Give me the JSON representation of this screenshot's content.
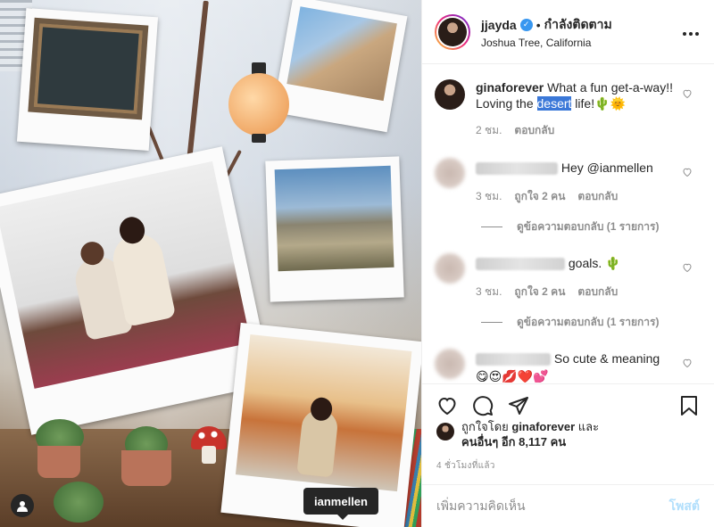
{
  "post": {
    "user_tag_tooltip": "ianmellen"
  },
  "header": {
    "username": "jjayda",
    "verified_mark": "✓",
    "separator": "•",
    "follow_status": "กำลังติดตาม",
    "location": "Joshua Tree, California",
    "more_icon": "more-horizontal-icon"
  },
  "comments": [
    {
      "username": "ginaforever",
      "text_before": "What a fun get-a-way!! Loving the ",
      "highlight": "desert",
      "text_after": " life!🌵🌞",
      "time": "2 ชม.",
      "likes": "",
      "reply": "ตอบกลับ"
    },
    {
      "username_blurred": true,
      "text": "Hey @ianmellen",
      "time": "3 ชม.",
      "likes": "ถูกใจ 2 คน",
      "reply": "ตอบกลับ",
      "view_replies": "ดูข้อความตอบกลับ (1 รายการ)"
    },
    {
      "username_blurred": true,
      "text": "goals. 🌵",
      "time": "3 ชม.",
      "likes": "ถูกใจ 2 คน",
      "reply": "ตอบกลับ",
      "view_replies": "ดูข้อความตอบกลับ (1 รายการ)"
    },
    {
      "username_blurred": true,
      "text": "So cute & meaning",
      "emoji_line": "😋😍💋❤️💕"
    }
  ],
  "likes": {
    "prefix": "ถูกใจโดย ",
    "liker": "ginaforever",
    "and": " และ",
    "others": "คนอื่นๆ อีก 8,117 คน"
  },
  "time_ago": "4 ชั่วโมงที่แล้ว",
  "add_comment": {
    "placeholder": "เพิ่มความคิดเห็น",
    "post_label": "โพสต์"
  },
  "colors": {
    "verified": "#3897f0",
    "link_muted": "#b2dffc",
    "highlight": "#3b78d8"
  }
}
